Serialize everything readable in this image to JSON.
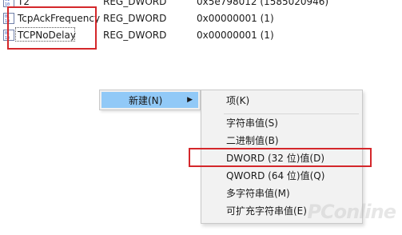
{
  "registry_values": [
    {
      "name": "T2",
      "type": "REG_DWORD",
      "data": "0x5e798012 (1585020946)",
      "icon": "reg-binary-icon"
    },
    {
      "name": "TcpAckFrequency",
      "type": "REG_DWORD",
      "data": "0x00000001 (1)",
      "icon": "reg-binary-icon"
    },
    {
      "name": "TCPNoDelay",
      "type": "REG_DWORD",
      "data": "0x00000001 (1)",
      "icon": "reg-binary-icon"
    }
  ],
  "context_menu": {
    "new_label": "新建(N)",
    "submenu_arrow": "›"
  },
  "submenu": {
    "items": [
      {
        "label": "项(K)"
      },
      {
        "label": "字符串值(S)"
      },
      {
        "label": "二进制值(B)"
      },
      {
        "label": "DWORD (32 位)值(D)"
      },
      {
        "label": "QWORD (64 位)值(Q)"
      },
      {
        "label": "多字符串值(M)"
      },
      {
        "label": "可扩充字符串值(E)"
      }
    ]
  },
  "watermark": {
    "logo": "PConline"
  },
  "colors": {
    "highlight_box": "#d4272b",
    "menu_hover": "#91c9f7",
    "menu_bg": "#f2f2f2"
  }
}
